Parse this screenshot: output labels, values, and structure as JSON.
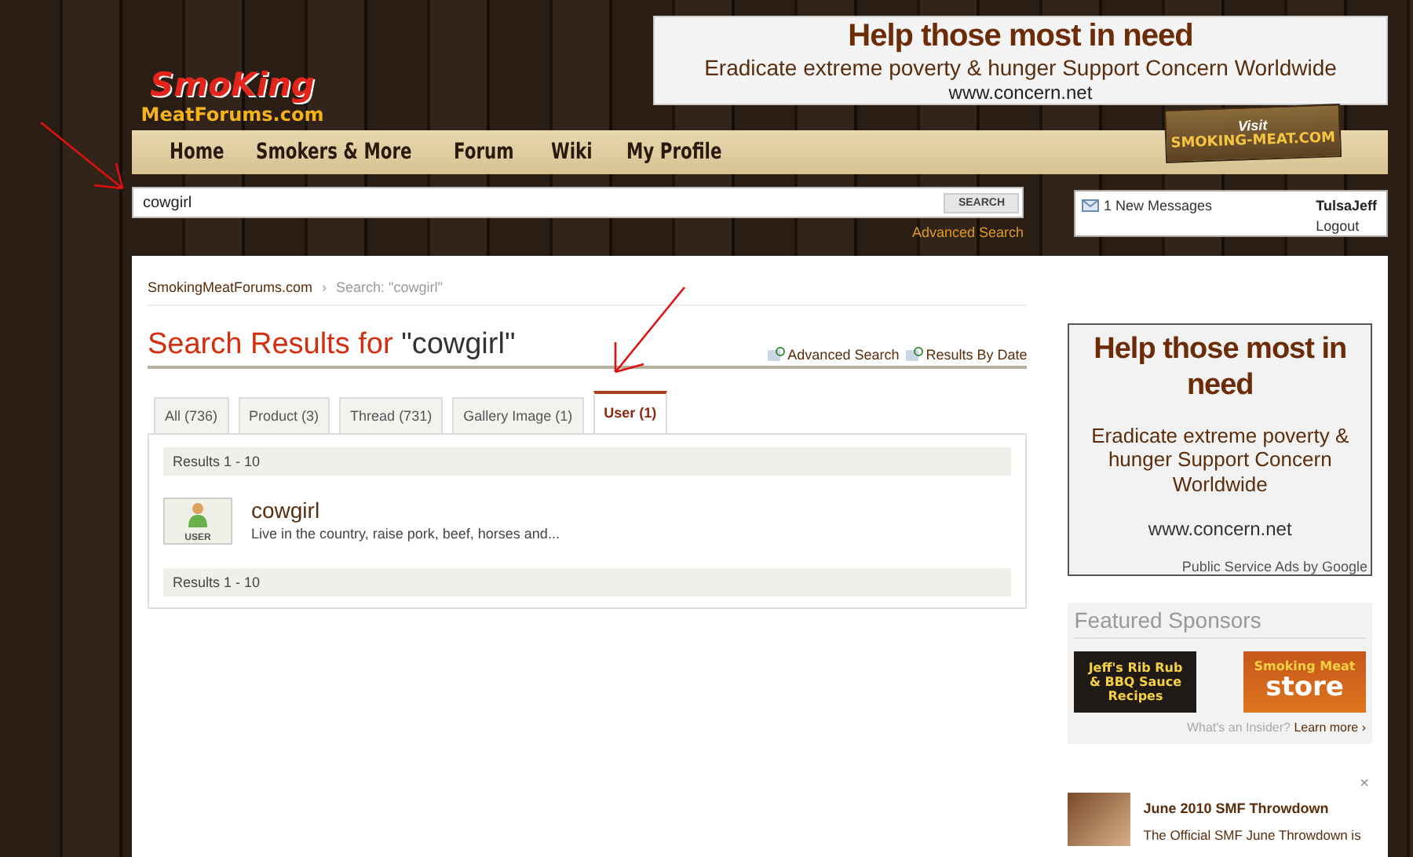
{
  "logo": {
    "line1": "SmoKing",
    "line2": "MeatForums.com"
  },
  "top_ad": {
    "title": "Help those most in need",
    "text": "Eradicate extreme poverty & hunger Support Concern Worldwide",
    "url": "www.concern.net"
  },
  "nav": [
    "Home",
    "Smokers & More",
    "Forum",
    "Wiki",
    "My Profile"
  ],
  "visit_sign": {
    "line1": "Visit",
    "line2": "SMOKING-MEAT.COM"
  },
  "search": {
    "value": "cowgirl",
    "button": "SEARCH",
    "advanced": "Advanced Search"
  },
  "user_box": {
    "messages": "1 New Messages",
    "user": "TulsaJeff",
    "logout": "Logout"
  },
  "breadcrumb": [
    "SmokingMeatForums.com",
    "Search: \"cowgirl\""
  ],
  "breadcrumb_separator": "›",
  "heading": {
    "prefix": "Search Results for",
    "query": "\"cowgirl\""
  },
  "heading_links": [
    "Advanced Search",
    "Results By Date"
  ],
  "tabs": [
    {
      "label": "All (736)",
      "selected": false
    },
    {
      "label": "Product (3)",
      "selected": false
    },
    {
      "label": "Thread (731)",
      "selected": false
    },
    {
      "label": "Gallery Image (1)",
      "selected": false
    },
    {
      "label": "User (1)",
      "selected": true
    }
  ],
  "results_header": "Results 1 - 10",
  "results": [
    {
      "badge": "USER",
      "name": "cowgirl",
      "snippet": "Live in the country, raise pork, beef, horses and..."
    }
  ],
  "results_footer": "Results 1 - 10",
  "side_ad": {
    "title": "Help those most in need",
    "text": "Eradicate extreme poverty & hunger Support Concern Worldwide",
    "url": "www.concern.net",
    "credit": "Public Service Ads by Google"
  },
  "sponsors": {
    "title": "Featured Sponsors",
    "banners": [
      {
        "kind": "rub",
        "lines": [
          "Jeff's Rib Rub",
          "& BBQ Sauce",
          "Recipes"
        ]
      },
      {
        "kind": "store",
        "lines": [
          "Smoking Meat",
          "store"
        ]
      }
    ],
    "question": "What's an Insider?",
    "link": "Learn more ›"
  },
  "close": "×",
  "feature": {
    "title": "June 2010 SMF Throwdown",
    "text": "The Official SMF June Throwdown is"
  }
}
